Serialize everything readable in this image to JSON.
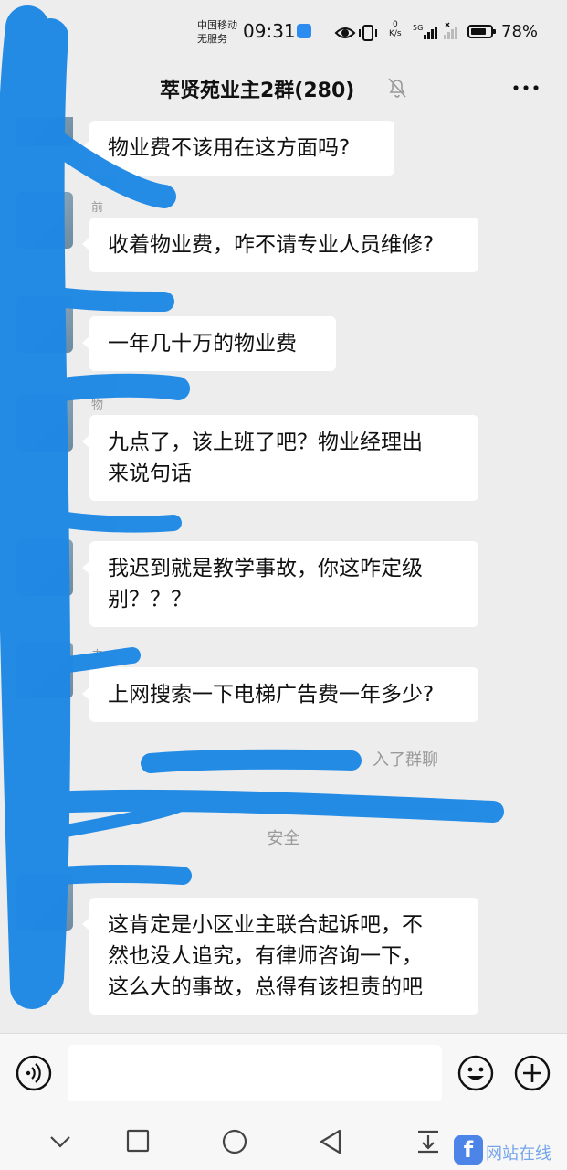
{
  "status_bar": {
    "carrier_line1": "中国移动",
    "carrier_line2": "无服务",
    "time": "09:31",
    "net_speed_value": "0",
    "net_speed_unit": "K/s",
    "network_label": "5G",
    "battery_percent": "78%",
    "battery_level": 0.78
  },
  "header": {
    "title": "萃贤苑业主2群(280)",
    "muted": true
  },
  "messages": [
    {
      "text_lines": [
        "物业费不该用在这方面吗?"
      ]
    },
    {
      "sender": "前",
      "text_lines": [
        "收着物业费，咋不请专业人员维修?"
      ]
    },
    {
      "text_lines": [
        "一年几十万的物业费"
      ]
    },
    {
      "sender": "物",
      "text_lines": [
        "九点了，该上班了吧？物业经理出",
        "来说句话"
      ]
    },
    {
      "text_lines": [
        "我迟到就是教学事故，你这咋定级",
        "别？？？"
      ]
    },
    {
      "sender": "夫",
      "text_lines": [
        "上网搜索一下电梯广告费一年多少?"
      ]
    },
    {
      "text_lines": [
        "这肯定是小区业主联合起诉吧，不",
        "然也没人追究，有律师咨询一下，",
        "这么大的事故，总得有该担责的吧"
      ]
    }
  ],
  "system_messages": [
    {
      "text": "入了群聊"
    },
    {
      "text": "安全"
    }
  ],
  "input": {
    "placeholder": ""
  },
  "watermark": {
    "logo": "f",
    "text": "网站在线"
  }
}
